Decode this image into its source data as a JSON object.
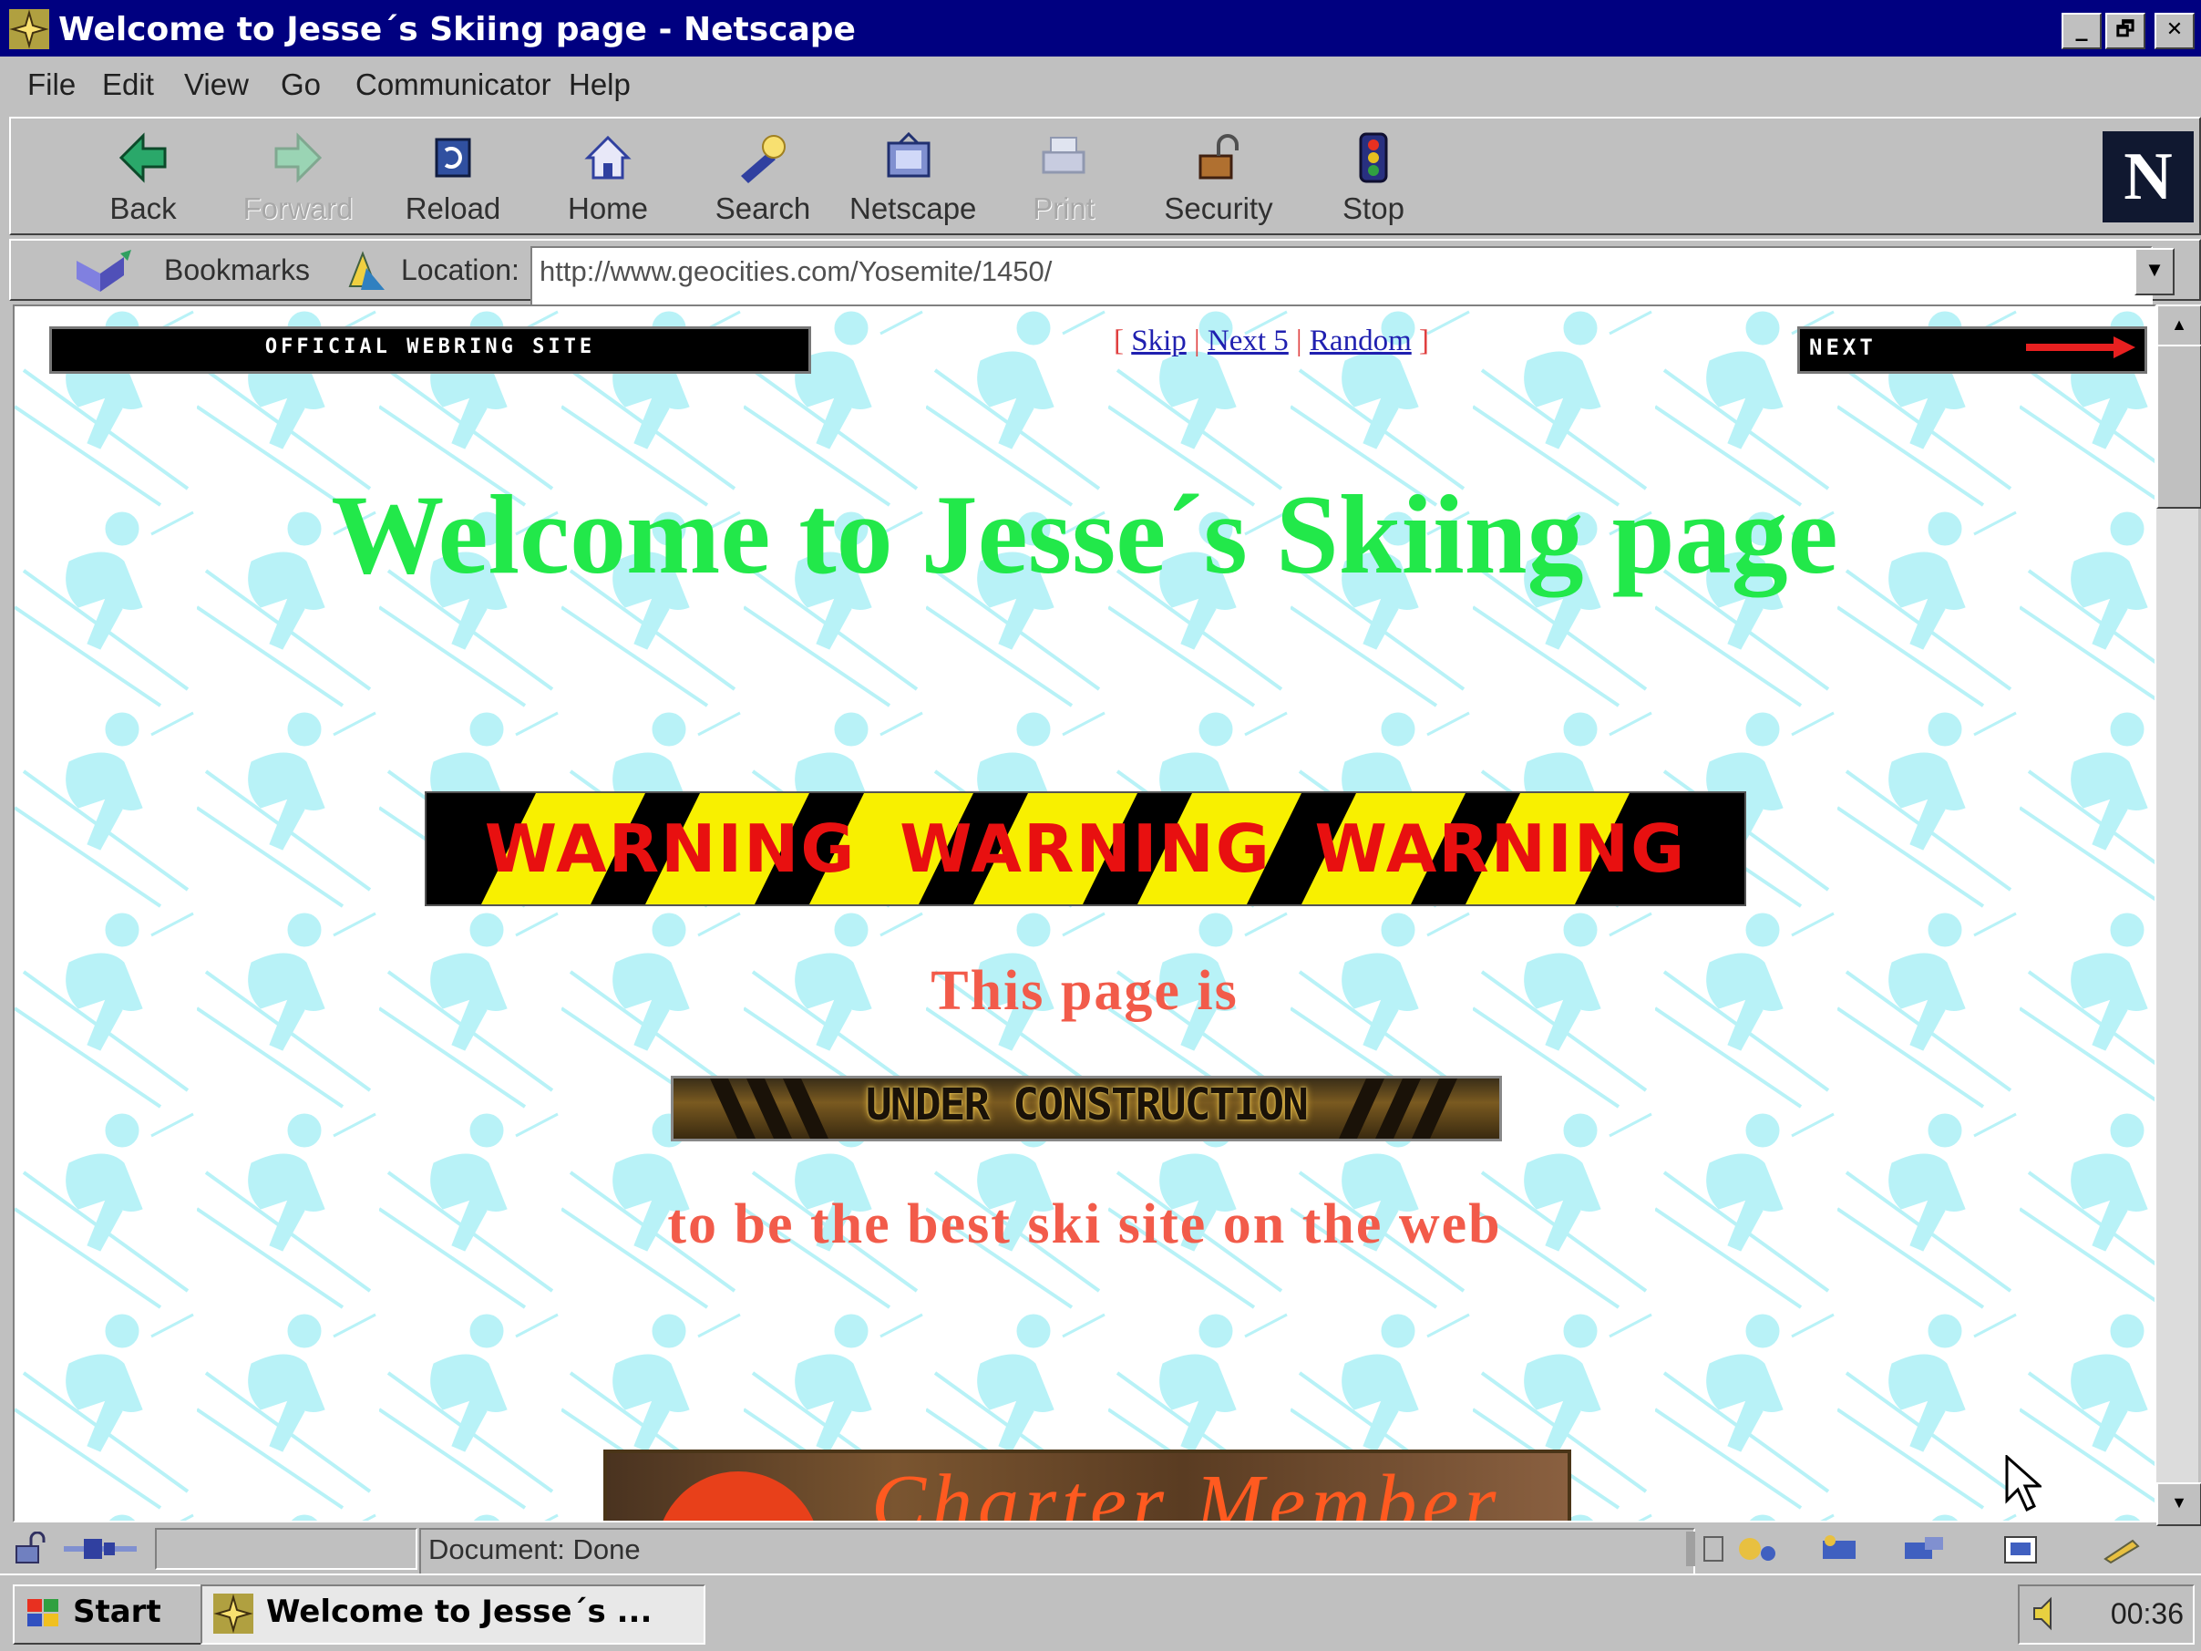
{
  "window": {
    "title": "Welcome to Jesse´s Skiing page - Netscape",
    "buttons": {
      "minimize": "_",
      "maximize": "🗗",
      "close": "✕"
    }
  },
  "menu": [
    {
      "label": "File"
    },
    {
      "label": "Edit"
    },
    {
      "label": "View"
    },
    {
      "label": "Go"
    },
    {
      "label": "Communicator"
    },
    {
      "label": "Help"
    }
  ],
  "toolbar": [
    {
      "label": "Back",
      "icon": "back-arrow-icon",
      "enabled": true
    },
    {
      "label": "Forward",
      "icon": "forward-arrow-icon",
      "enabled": false
    },
    {
      "label": "Reload",
      "icon": "reload-icon",
      "enabled": true
    },
    {
      "label": "Home",
      "icon": "home-icon",
      "enabled": true
    },
    {
      "label": "Search",
      "icon": "search-icon",
      "enabled": true
    },
    {
      "label": "Netscape",
      "icon": "netscape-icon",
      "enabled": true
    },
    {
      "label": "Print",
      "icon": "printer-icon",
      "enabled": false
    },
    {
      "label": "Security",
      "icon": "lock-icon",
      "enabled": true
    },
    {
      "label": "Stop",
      "icon": "stop-icon",
      "enabled": true
    }
  ],
  "brand_logo": "N",
  "location_bar": {
    "bookmarks_label": "Bookmarks",
    "location_label": "Location:",
    "url": "http://www.geocities.com/Yosemite/1450/"
  },
  "page": {
    "webring_banner": "OFFICIAL WEBRING SITE",
    "ring_nav": {
      "open": "[ ",
      "skip": "Skip",
      "next5": "Next 5",
      "random": "Random",
      "sep": " | ",
      "close": " ]"
    },
    "next_banner": "NEXT",
    "heading": "Welcome to Jesse´s Skiing page",
    "warning_words": [
      "WARNING",
      "WARNING",
      "WARNING"
    ],
    "line1": "This page is",
    "under_construction": "UNDER CONSTRUCTION",
    "line2": "to be the best ski site on the web",
    "member_banner": "Charter Member",
    "colors": {
      "heading": "#22e84a",
      "red_text": "#f25b4a",
      "pattern": "#b8f2f7",
      "link": "#2020b0"
    }
  },
  "status": {
    "text": "Document: Done"
  },
  "taskbar": {
    "start_label": "Start",
    "task_label": "Welcome to Jesse´s ...",
    "clock": "00:36"
  }
}
